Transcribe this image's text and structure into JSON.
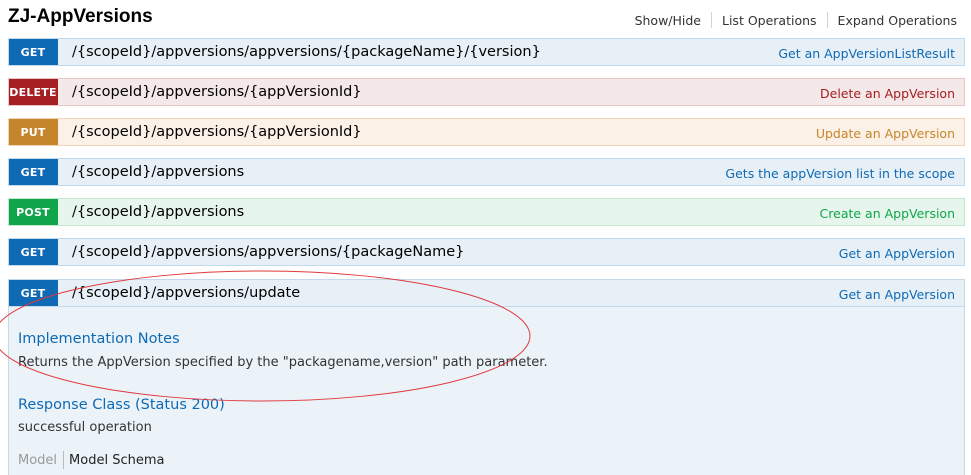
{
  "header": {
    "title": "ZJ-AppVersions",
    "links": [
      "Show/Hide",
      "List Operations",
      "Expand Operations"
    ]
  },
  "operations": [
    {
      "method": "GET",
      "path": "/{scopeId}/appversions/appversions/{packageName}/{version}",
      "summary": "Get an AppVersionListResult"
    },
    {
      "method": "DELETE",
      "path": "/{scopeId}/appversions/{appVersionId}",
      "summary": "Delete an AppVersion"
    },
    {
      "method": "PUT",
      "path": "/{scopeId}/appversions/{appVersionId}",
      "summary": "Update an AppVersion"
    },
    {
      "method": "GET",
      "path": "/{scopeId}/appversions",
      "summary": "Gets the appVersion list in the scope"
    },
    {
      "method": "POST",
      "path": "/{scopeId}/appversions",
      "summary": "Create an AppVersion"
    },
    {
      "method": "GET",
      "path": "/{scopeId}/appversions/appversions/{packageName}",
      "summary": "Get an AppVersion"
    },
    {
      "method": "GET",
      "path": "/{scopeId}/appversions/update",
      "summary": "Get an AppVersion"
    }
  ],
  "expanded": {
    "implementation_heading": "Implementation Notes",
    "implementation_text": "Returns the AppVersion specified by the \"packagename,version\" path parameter.",
    "response_heading": "Response Class (Status 200)",
    "response_text": "successful operation",
    "tabs": [
      "Model",
      "Model Schema"
    ]
  },
  "colors": {
    "get": "#0f6ab4",
    "delete": "#a41e22",
    "put": "#c5862b",
    "post": "#10a54a",
    "annotation": "#e0393b"
  }
}
